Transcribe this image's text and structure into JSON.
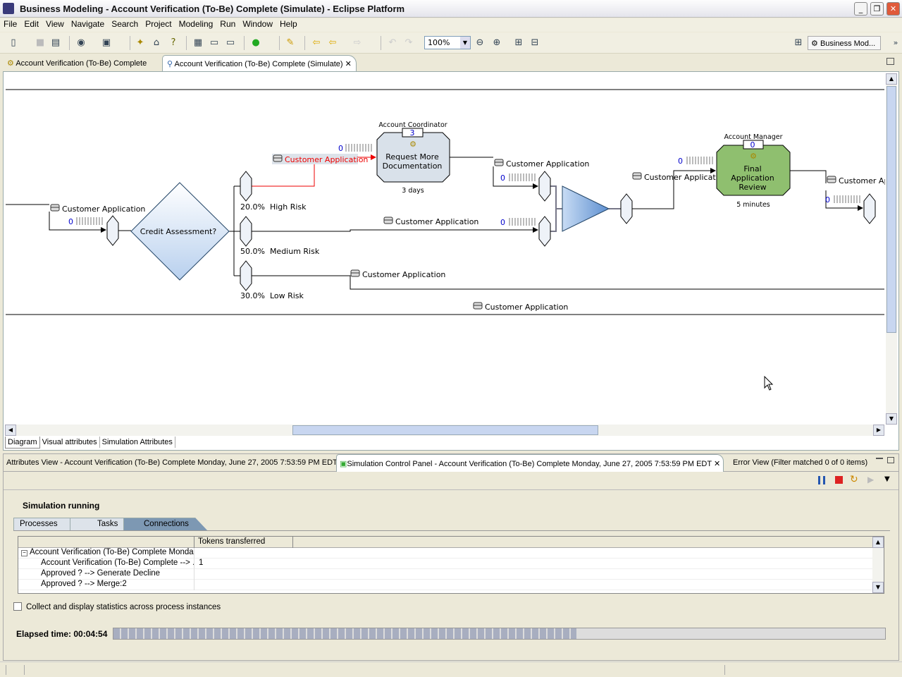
{
  "window": {
    "title": "Business Modeling - Account Verification (To-Be) Complete (Simulate) - Eclipse Platform"
  },
  "menu": [
    "File",
    "Edit",
    "View",
    "Navigate",
    "Search",
    "Project",
    "Modeling",
    "Run",
    "Window",
    "Help"
  ],
  "toolbar": {
    "zoom": "100%",
    "perspective": "Business Mod...",
    "more": "»"
  },
  "editor_tabs": [
    {
      "label": "Account Verification (To-Be) Complete"
    },
    {
      "label": "Account Verification (To-Be) Complete (Simulate)",
      "active": true
    }
  ],
  "diagram": {
    "input_label": "Customer Application",
    "input_count": "0",
    "decision": "Credit Assessment?",
    "branches": [
      {
        "label": "20.0%  High Risk"
      },
      {
        "label": "50.0%  Medium Risk"
      },
      {
        "label": "30.0%  Low Risk"
      }
    ],
    "high_conn_label": "Customer Application",
    "high_count": "0",
    "task1": {
      "role": "Account Coordinator",
      "queue": "3",
      "name1": "Request More",
      "name2": "Documentation",
      "duration": "3 days"
    },
    "task1_out_label": "Customer Application",
    "task1_out_count": "0",
    "medium_label": "Customer Application",
    "medium_count": "0",
    "low_label": "Customer Application",
    "bottom_label": "Customer Application",
    "merge_out_label": "Customer Application",
    "merge_out_count": "0",
    "task2": {
      "role": "Account Manager",
      "queue": "0",
      "name1": "Final",
      "name2": "Application",
      "name3": "Review",
      "duration": "5 minutes",
      "color": "#8fbf6f"
    },
    "task2_out_label": "Customer App",
    "task2_out_count": "0"
  },
  "editor_bottom_tabs": [
    "Diagram",
    "Visual attributes",
    "Simulation Attributes"
  ],
  "views": [
    {
      "label": "Attributes View - Account Verification (To-Be) Complete Monday, June 27, 2005 7:53:59 PM EDT"
    },
    {
      "label": "Simulation Control Panel - Account Verification (To-Be) Complete Monday, June 27, 2005 7:53:59 PM EDT",
      "active": true
    },
    {
      "label": "Error View (Filter matched 0 of 0 items)"
    }
  ],
  "sim": {
    "state": "Simulation running",
    "tabs": [
      "Processes",
      "Tasks",
      "Connections"
    ],
    "active_tab": "Connections",
    "columns": [
      "",
      "Tokens transferred"
    ],
    "rows": [
      {
        "name": "Account Verification (To-Be) Complete Monda...",
        "value": ""
      },
      {
        "name": "Account Verification (To-Be) Complete --> ...",
        "value": "1"
      },
      {
        "name": "Approved ? --> Generate Decline",
        "value": ""
      },
      {
        "name": "Approved ? --> Merge:2",
        "value": ""
      }
    ],
    "collect_label": "Collect and display statistics across process instances",
    "collect_checked": false,
    "elapsed": "Elapsed time: 00:04:54",
    "progress_percent": 60
  }
}
